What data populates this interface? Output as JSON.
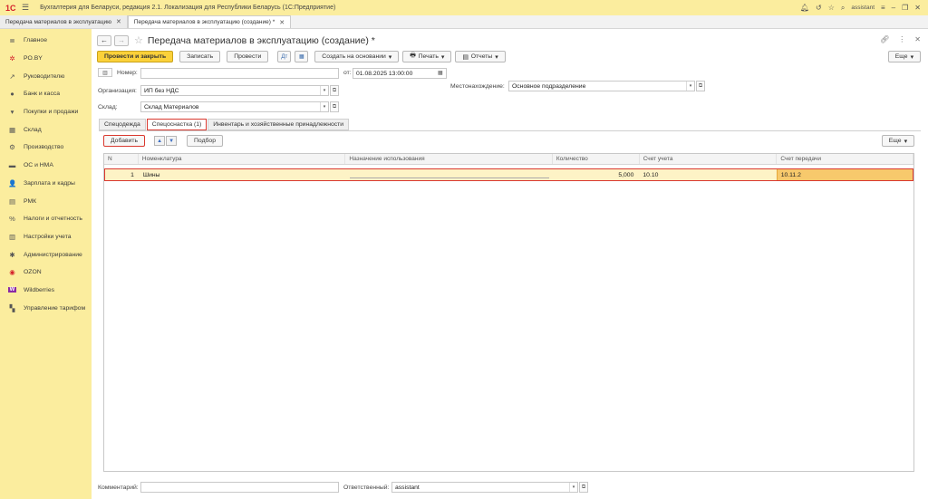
{
  "app": {
    "logo": "1С",
    "title": "Бухгалтерия для Беларуси, редакция 2.1. Локализация для Республики Беларусь   (1С:Предприятие)",
    "user": "assistant"
  },
  "window_tabs": [
    {
      "label": "Передача материалов в эксплуатацию"
    },
    {
      "label": "Передача материалов в эксплуатацию (создание) *"
    }
  ],
  "sidebar": {
    "items": [
      {
        "label": "Главное",
        "icon": "≣"
      },
      {
        "label": "PO.BY",
        "icon": "✲"
      },
      {
        "label": "Руководителю",
        "icon": "↗"
      },
      {
        "label": "Банк и касса",
        "icon": "●"
      },
      {
        "label": "Покупки и продажи",
        "icon": "▾"
      },
      {
        "label": "Склад",
        "icon": "▦"
      },
      {
        "label": "Производство",
        "icon": "⚙"
      },
      {
        "label": "ОС и НМА",
        "icon": "▬"
      },
      {
        "label": "Зарплата и кадры",
        "icon": "👤"
      },
      {
        "label": "РМК",
        "icon": "▤"
      },
      {
        "label": "Налоги и отчетность",
        "icon": "%"
      },
      {
        "label": "Настройки учета",
        "icon": "▥"
      },
      {
        "label": "Администрирование",
        "icon": "✱"
      },
      {
        "label": "OZON",
        "icon": "◉"
      },
      {
        "label": "Wildberries",
        "icon": "W"
      },
      {
        "label": "Управление тарифом",
        "icon": "▚"
      }
    ]
  },
  "document": {
    "title": "Передача материалов в эксплуатацию (создание) *",
    "toolbar": {
      "post_close": "Провести и закрыть",
      "save": "Записать",
      "post": "Провести",
      "create_based": "Создать на основании",
      "print": "Печать",
      "reports": "Отчеты",
      "more": "Еще"
    },
    "fields": {
      "number_label": "Номер:",
      "number_value": "",
      "date_label": "от:",
      "date_value": "01.08.2025 13:00:00",
      "org_label": "Организация:",
      "org_value": "ИП без НДС",
      "location_label": "Местонахождение:",
      "location_value": "Основное подразделение",
      "warehouse_label": "Склад:",
      "warehouse_value": "Склад Материалов"
    },
    "tabs": [
      {
        "label": "Спецодежда"
      },
      {
        "label": "Спецоснастка (1)"
      },
      {
        "label": "Инвентарь и хозяйственные принадлежности"
      }
    ],
    "table_toolbar": {
      "add": "Добавить",
      "pick": "Подбор",
      "more": "Еще"
    },
    "table": {
      "columns": [
        "N",
        "Номенклатура",
        "Назначение использования",
        "Количество",
        "Счет учета",
        "Счет передачи"
      ],
      "rows": [
        {
          "n": "1",
          "nom": "Шины",
          "naz": "",
          "qty": "5,000",
          "acc": "10.10",
          "tr": "10.11.2"
        }
      ]
    },
    "footer": {
      "comment_label": "Комментарий:",
      "comment_value": "",
      "responsible_label": "Ответственный:",
      "responsible_value": "assistant"
    }
  }
}
